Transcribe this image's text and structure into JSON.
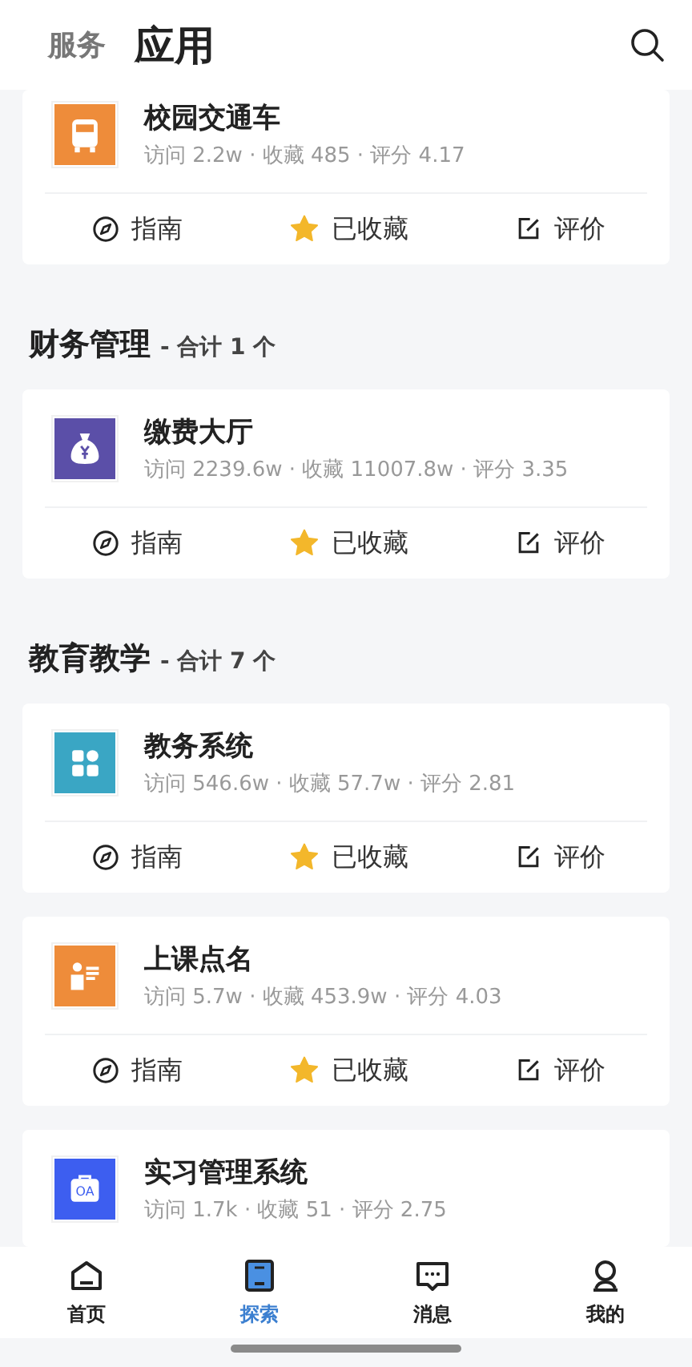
{
  "header": {
    "tabs": [
      {
        "label": "服务",
        "selected": false
      },
      {
        "label": "应用",
        "selected": true
      }
    ]
  },
  "sections": [
    {
      "apps": [
        {
          "name": "校园交通车",
          "stats": "访问 2.2w · 收藏 485 · 评分 4.17",
          "color": "#ee8c3a",
          "actions": [
            {
              "kind": "guide",
              "label": "指南"
            },
            {
              "kind": "favorite",
              "label": "已收藏",
              "on": true
            },
            {
              "kind": "review",
              "label": "评价"
            }
          ]
        }
      ]
    },
    {
      "title": "财务管理",
      "count": "- 合计 1 个",
      "apps": [
        {
          "name": "缴费大厅",
          "stats": "访问 2239.6w · 收藏 11007.8w · 评分 3.35",
          "color": "#5b4fa8",
          "actions": [
            {
              "kind": "guide",
              "label": "指南"
            },
            {
              "kind": "favorite",
              "label": "已收藏",
              "on": true
            },
            {
              "kind": "review",
              "label": "评价"
            }
          ]
        }
      ]
    },
    {
      "title": "教育教学",
      "count": "- 合计 7 个",
      "apps": [
        {
          "name": "教务系统",
          "stats": "访问 546.6w · 收藏 57.7w · 评分 2.81",
          "color": "#3aa6c4",
          "actions": [
            {
              "kind": "guide",
              "label": "指南"
            },
            {
              "kind": "favorite",
              "label": "已收藏",
              "on": true
            },
            {
              "kind": "review",
              "label": "评价"
            }
          ]
        },
        {
          "name": "上课点名",
          "stats": "访问 5.7w · 收藏 453.9w · 评分 4.03",
          "color": "#ee8c3a",
          "actions": [
            {
              "kind": "guide",
              "label": "指南"
            },
            {
              "kind": "favorite",
              "label": "已收藏",
              "on": true
            },
            {
              "kind": "review",
              "label": "评价"
            }
          ]
        },
        {
          "name": "实习管理系统",
          "stats": "访问 1.7k · 收藏 51 · 评分 2.75",
          "color": "#3d5ef0",
          "icon_text": "OA"
        }
      ]
    }
  ],
  "tab_bar": [
    {
      "label": "首页",
      "selected": false
    },
    {
      "label": "探索",
      "selected": true
    },
    {
      "label": "消息",
      "selected": false
    },
    {
      "label": "我的",
      "selected": false
    }
  ]
}
